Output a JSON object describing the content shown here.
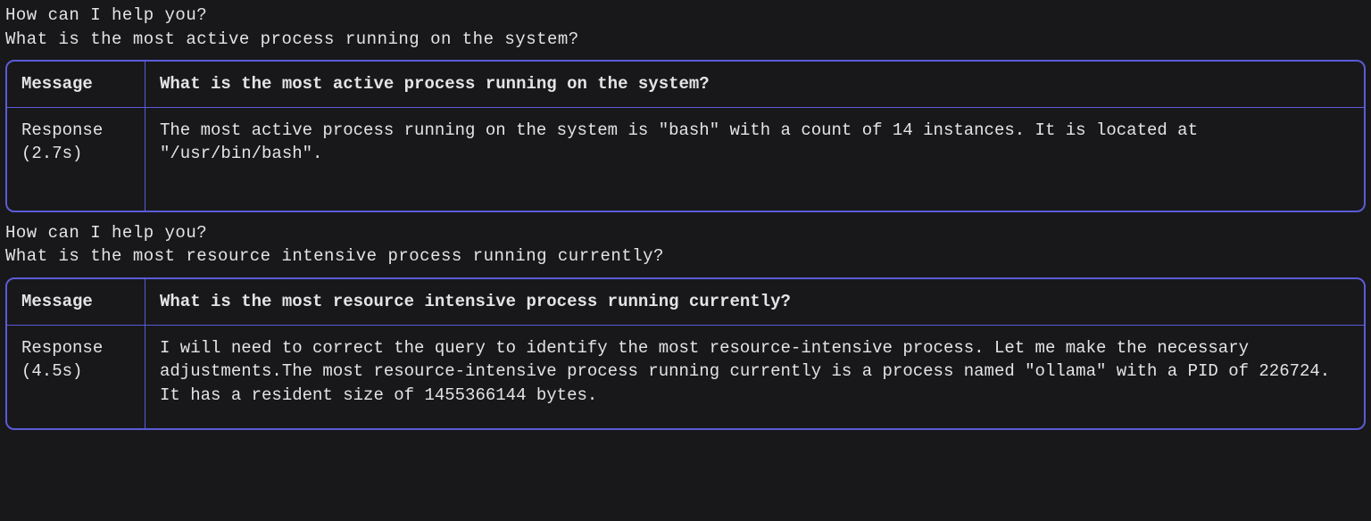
{
  "conversations": [
    {
      "prompt": "How can I help you?",
      "user_input": "What is the most active process running on the system?",
      "message_label": "Message",
      "message_content": "What is the most active process running on the system?",
      "response_label": "Response (2.7s)",
      "response_content": "The most active process running on the system is \"bash\" with a count of 14 instances. It is located at \"/usr/bin/bash\"."
    },
    {
      "prompt": "How can I help you?",
      "user_input": "What is the most resource intensive process running currently?",
      "message_label": "Message",
      "message_content": "What is the most resource intensive process running currently?",
      "response_label": "Response (4.5s)",
      "response_content": "I will need to correct the query to identify the most resource-intensive process. Let me make the necessary adjustments.The most resource-intensive process running currently is a process named \"ollama\" with a PID of 226724. It has a resident size of 1455366144 bytes."
    }
  ]
}
